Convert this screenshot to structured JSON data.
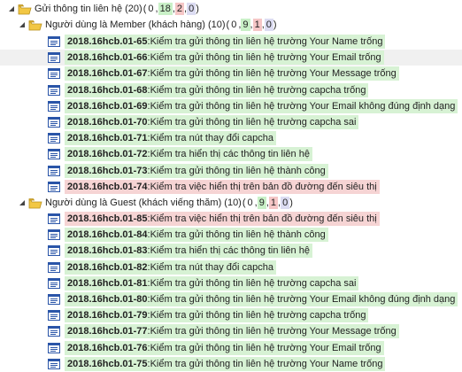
{
  "root": {
    "label": "Gửi thông tin liên hệ (20)",
    "counts": [
      "0",
      "18",
      "2",
      "0"
    ]
  },
  "groups": [
    {
      "label": "Người dùng là Member (khách hàng) (10)",
      "counts": [
        "0",
        "9",
        "1",
        "0"
      ],
      "items": [
        {
          "id": "2018.16hcb.01-65",
          "title": ":Kiểm tra gửi thông tin liên hệ trường Your Name trống",
          "status": "pass"
        },
        {
          "id": "2018.16hcb.01-66",
          "title": ":Kiểm tra gửi thông tin liên hệ trường Your Email trống",
          "status": "pass"
        },
        {
          "id": "2018.16hcb.01-67",
          "title": ":Kiểm tra gửi thông tin liên hệ trường Your Message trống",
          "status": "pass"
        },
        {
          "id": "2018.16hcb.01-68",
          "title": ":Kiểm tra gửi thông tin liên hệ trường capcha trống",
          "status": "pass"
        },
        {
          "id": "2018.16hcb.01-69",
          "title": ":Kiểm tra gửi thông tin liên hệ trường Your Email không đúng định dạng",
          "status": "pass"
        },
        {
          "id": "2018.16hcb.01-70",
          "title": ":Kiểm tra gửi thông tin liên hệ trường capcha sai",
          "status": "pass"
        },
        {
          "id": "2018.16hcb.01-71",
          "title": ":Kiểm tra nút thay đổi capcha",
          "status": "pass"
        },
        {
          "id": "2018.16hcb.01-72",
          "title": ":Kiểm tra hiển thị các thông tin liên hệ",
          "status": "pass"
        },
        {
          "id": "2018.16hcb.01-73",
          "title": ":Kiểm tra gửi thông tin liên hệ thành công",
          "status": "pass"
        },
        {
          "id": "2018.16hcb.01-74",
          "title": ":Kiểm tra việc hiển thị trên bản đồ đường đến siêu thị",
          "status": "fail"
        }
      ]
    },
    {
      "label": "Người dùng là Guest (khách viếng thăm) (10)",
      "counts": [
        "0",
        "9",
        "1",
        "0"
      ],
      "items": [
        {
          "id": "2018.16hcb.01-85",
          "title": ":Kiểm tra việc hiển thị trên bản đồ đường đến siêu thị",
          "status": "fail"
        },
        {
          "id": "2018.16hcb.01-84",
          "title": ":Kiểm tra gửi thông tin liên hệ thành công",
          "status": "pass"
        },
        {
          "id": "2018.16hcb.01-83",
          "title": ":Kiểm tra hiển thị các thông tin liên hệ",
          "status": "pass"
        },
        {
          "id": "2018.16hcb.01-82",
          "title": ":Kiểm tra nút thay đổi capcha",
          "status": "pass"
        },
        {
          "id": "2018.16hcb.01-81",
          "title": ":Kiểm tra gửi thông tin liên hệ trường capcha sai",
          "status": "pass"
        },
        {
          "id": "2018.16hcb.01-80",
          "title": ":Kiểm tra gửi thông tin liên hệ trường Your Email không đúng định dạng",
          "status": "pass"
        },
        {
          "id": "2018.16hcb.01-79",
          "title": ":Kiểm tra gửi thông tin liên hệ trường capcha trống",
          "status": "pass"
        },
        {
          "id": "2018.16hcb.01-77",
          "title": ":Kiểm tra gửi thông tin liên hệ trường Your Message trống",
          "status": "pass"
        },
        {
          "id": "2018.16hcb.01-76",
          "title": ":Kiểm tra gửi thông tin liên hệ trường Your Email trống",
          "status": "pass"
        },
        {
          "id": "2018.16hcb.01-75",
          "title": ":Kiểm tra gửi thông tin liên hệ trường Your Name trống",
          "status": "pass"
        }
      ]
    }
  ],
  "selected_row": "2018.16hcb.01-66",
  "colors": {
    "pass_bg": "#d7f2d4",
    "fail_bg": "#f6d4d4",
    "blocked_bg": "#dcdcf2",
    "folder": "#f2c744"
  },
  "icons": {
    "expanded": "expanded-triangle-icon",
    "folder": "folder-icon",
    "testcase": "testcase-icon"
  }
}
